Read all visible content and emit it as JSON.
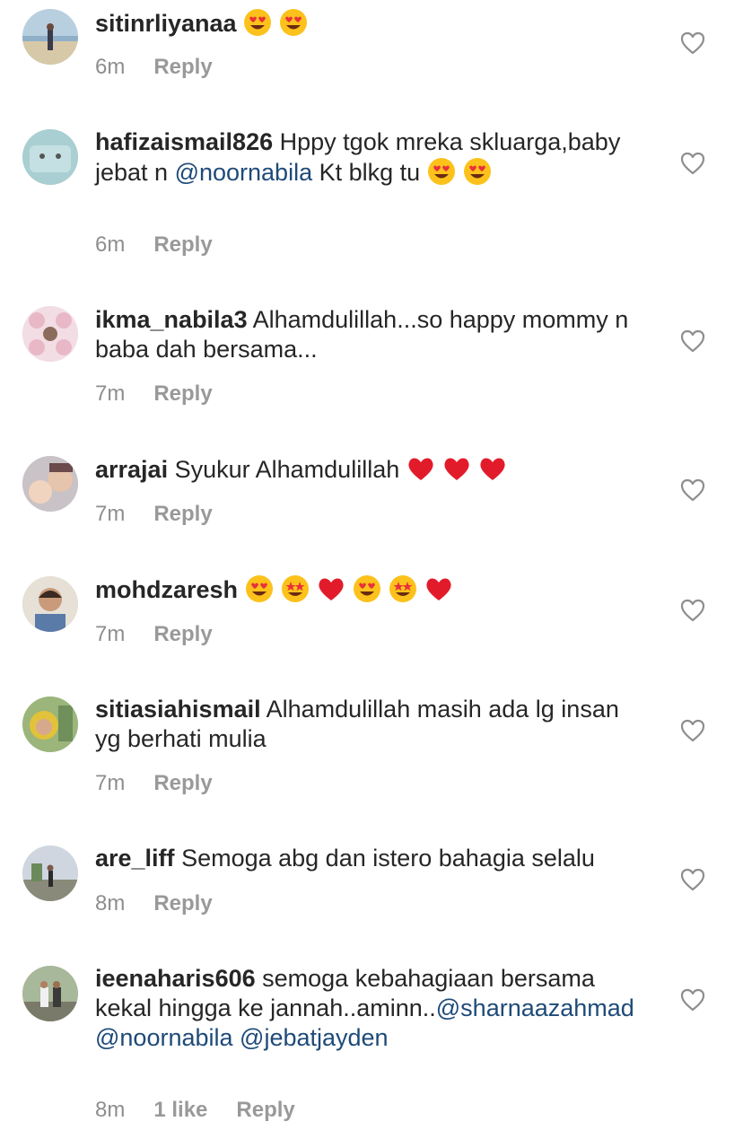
{
  "comments": [
    {
      "username": "sitinrliyanaa",
      "parts": [
        {
          "t": "emoji",
          "e": "heart-eyes"
        },
        {
          "t": "emoji",
          "e": "heart-eyes"
        }
      ],
      "time": "6m",
      "likes": "",
      "reply_label": "Reply"
    },
    {
      "username": "hafizaismail826",
      "parts": [
        {
          "t": "text",
          "v": "Hppy tgok mreka skluarga,baby jebat n "
        },
        {
          "t": "mention",
          "v": "@noornabila"
        },
        {
          "t": "text",
          "v": " Kt blkg tu "
        },
        {
          "t": "emoji",
          "e": "heart-eyes"
        },
        {
          "t": "emoji",
          "e": "heart-eyes"
        }
      ],
      "time": "6m",
      "likes": "",
      "reply_label": "Reply"
    },
    {
      "username": "ikma_nabila3",
      "parts": [
        {
          "t": "text",
          "v": "Alhamdulillah...so happy mommy n baba dah bersama..."
        }
      ],
      "time": "7m",
      "likes": "",
      "reply_label": "Reply"
    },
    {
      "username": "arrajai",
      "parts": [
        {
          "t": "text",
          "v": "Syukur Alhamdulillah "
        },
        {
          "t": "emoji",
          "e": "red-heart"
        },
        {
          "t": "emoji",
          "e": "red-heart"
        },
        {
          "t": "emoji",
          "e": "red-heart"
        }
      ],
      "time": "7m",
      "likes": "",
      "reply_label": "Reply"
    },
    {
      "username": "mohdzaresh",
      "parts": [
        {
          "t": "emoji",
          "e": "heart-eyes"
        },
        {
          "t": "emoji",
          "e": "star-struck"
        },
        {
          "t": "emoji",
          "e": "red-heart"
        },
        {
          "t": "emoji",
          "e": "heart-eyes"
        },
        {
          "t": "emoji",
          "e": "star-struck"
        },
        {
          "t": "emoji",
          "e": "red-heart"
        }
      ],
      "time": "7m",
      "likes": "",
      "reply_label": "Reply"
    },
    {
      "username": "sitiasiahismail",
      "parts": [
        {
          "t": "text",
          "v": "Alhamdulillah masih ada lg insan yg berhati mulia"
        }
      ],
      "time": "7m",
      "likes": "",
      "reply_label": "Reply"
    },
    {
      "username": "are_liff",
      "parts": [
        {
          "t": "text",
          "v": "Semoga abg dan istero bahagia selalu"
        }
      ],
      "time": "8m",
      "likes": "",
      "reply_label": "Reply"
    },
    {
      "username": "ieenaharis606",
      "parts": [
        {
          "t": "text",
          "v": "semoga kebahagiaan bersama kekal hingga ke jannah..aminn.."
        },
        {
          "t": "mention",
          "v": "@sharnaazahmad"
        },
        {
          "t": "text",
          "v": "  "
        },
        {
          "t": "mention",
          "v": "@noornabila"
        },
        {
          "t": "text",
          "v": " "
        },
        {
          "t": "mention",
          "v": "@jebatjayden"
        }
      ],
      "time": "8m",
      "likes": "1 like",
      "reply_label": "Reply"
    }
  ],
  "colors": {
    "mention": "#1e4a78",
    "meta": "#8e8e8e",
    "text": "#262626"
  },
  "icons": {
    "like": "heart-outline-icon"
  }
}
